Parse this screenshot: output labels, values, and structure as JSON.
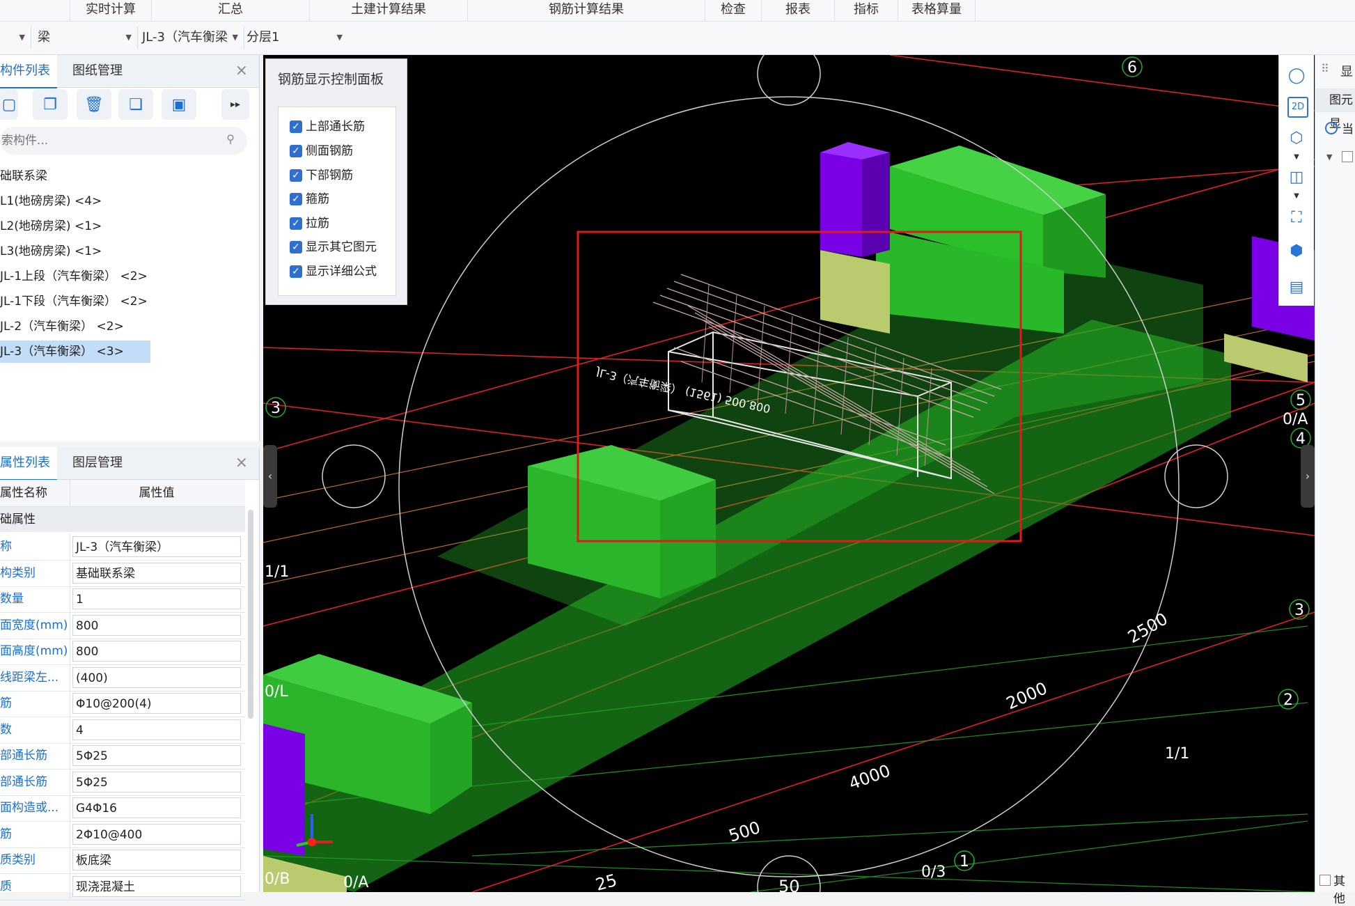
{
  "menu": [
    "实时计算",
    "汇总",
    "土建计算结果",
    "钢筋计算结果",
    "检查",
    "报表",
    "指标",
    "表格算量"
  ],
  "selectors": {
    "category": "梁",
    "component": "JL-3（汽车衡梁",
    "layer": "分层1"
  },
  "component_panel": {
    "tabs": [
      "构件列表",
      "图纸管理"
    ],
    "search_placeholder": "索构件...",
    "items": [
      "础联系梁",
      "L1(地磅房梁)  <4>",
      "L2(地磅房梁)  <1>",
      "L3(地磅房梁)  <1>",
      "JL-1上段（汽车衡梁） <2>",
      "JL-1下段（汽车衡梁） <2>",
      "JL-2（汽车衡梁） <2>",
      "JL-3（汽车衡梁） <3>"
    ]
  },
  "property_panel": {
    "tabs": [
      "属性列表",
      "图层管理"
    ],
    "header": {
      "name": "属性名称",
      "value": "属性值"
    },
    "group": "础属性",
    "rows": [
      {
        "name": "称",
        "value": "JL-3（汽车衡梁）"
      },
      {
        "name": "构类别",
        "value": "基础联系梁"
      },
      {
        "name": "数量",
        "value": "1"
      },
      {
        "name": "面宽度(mm)",
        "value": "800"
      },
      {
        "name": "面高度(mm)",
        "value": "800"
      },
      {
        "name": "线距梁左...",
        "value": "(400)"
      },
      {
        "name": "筋",
        "value": "Φ10@200(4)"
      },
      {
        "name": "数",
        "value": "4"
      },
      {
        "name": "部通长筋",
        "value": "5Φ25"
      },
      {
        "name": "部通长筋",
        "value": "5Φ25"
      },
      {
        "name": "面构造或...",
        "value": "G4Φ16"
      },
      {
        "name": "筋",
        "value": "2Φ10@400"
      },
      {
        "name": "质类别",
        "value": "板底梁"
      },
      {
        "name": "质",
        "value": "现浇混凝土"
      }
    ]
  },
  "rebar_panel": {
    "title": "钢筋显示控制面板",
    "options": [
      {
        "label": "上部通长筋",
        "checked": true
      },
      {
        "label": "侧面钢筋",
        "checked": true
      },
      {
        "label": "下部钢筋",
        "checked": true
      },
      {
        "label": "箍筋",
        "checked": true
      },
      {
        "label": "拉筋",
        "checked": true
      },
      {
        "label": "显示其它图元",
        "checked": true
      },
      {
        "label": "显示详细公式",
        "checked": true
      }
    ]
  },
  "viewport": {
    "grid_labels": [
      "6",
      "3",
      "1/1",
      "0/L",
      "0/B",
      "0/A",
      "5",
      "0/A",
      "4",
      "3",
      "2",
      "1/1",
      "1",
      "0/3"
    ],
    "dimensions": [
      "2500",
      "2000",
      "4000",
      "500",
      "25",
      "50"
    ],
    "beam_label": "JL-3（汽车衡梁） (1561) 500.800"
  },
  "right_panel": {
    "tab": "显",
    "header": "图元显",
    "radio": "当",
    "footer": "其他"
  },
  "colors": {
    "accent": "#1a6fd6",
    "beam": "#22b022",
    "column": "#7a00e6",
    "axis": "#e02020",
    "highlight": "#e01a1a"
  }
}
